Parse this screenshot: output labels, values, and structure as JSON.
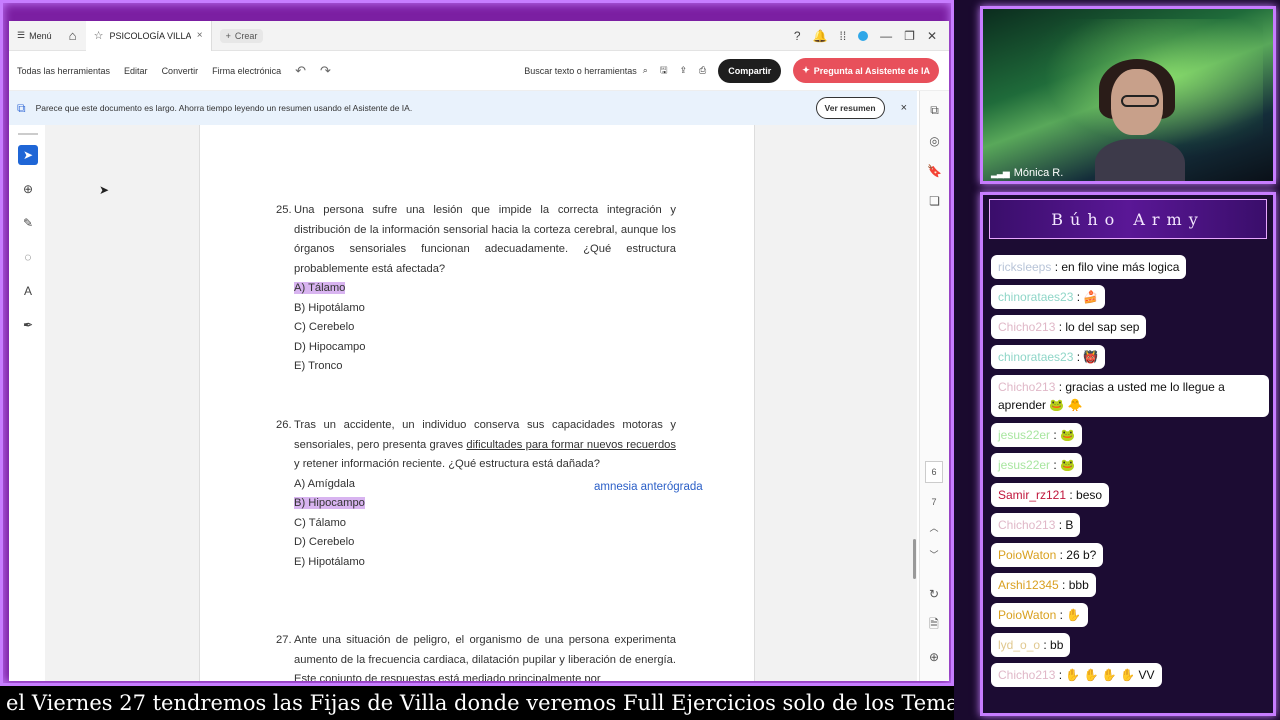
{
  "app": {
    "menu_label": "Menú",
    "tab_title": "PSICOLOGÍA VILLAR...",
    "new_tab_label": "Crear"
  },
  "toolbar": {
    "items": [
      "Todas las herramientas",
      "Editar",
      "Convertir",
      "Firma electrónica"
    ],
    "search_label": "Buscar texto o herramientas",
    "share_label": "Compartir",
    "ai_label": "Pregunta al Asistente de IA"
  },
  "notice": {
    "text": "Parece que este documento es largo. Ahorra tiempo leyendo un resumen usando el Asistente de IA.",
    "view_button": "Ver resumen",
    "close": "×"
  },
  "document": {
    "questions": [
      {
        "number": "25.",
        "stem": "Una persona sufre una lesión que impide la correcta integración y distribución de la información sensorial hacia la corteza cerebral, aunque los órganos sensoriales funcionan adecuadamente. ¿Qué estructura probablemente está afectada?",
        "options": [
          "A)  Tálamo",
          "B)  Hipotálamo",
          "C)  Cerebelo",
          "D)  Hipocampo",
          "E)  Tronco"
        ],
        "highlighted": 0
      },
      {
        "number": "26.",
        "stem_before": "Tras un accidente, un individuo conserva sus capacidades motoras y sensoriales, pero presenta graves ",
        "stem_underlined": "dificultades para formar nuevos recuerdos",
        "stem_after": " y retener información reciente. ¿Qué estructura está dañada?",
        "options": [
          "A)  Amígdala",
          "B)  Hipocampo",
          "C)  Tálamo",
          "D)  Cerebelo",
          "E)  Hipotálamo"
        ],
        "highlighted": 1,
        "annotation": "amnesia anterógrada"
      },
      {
        "number": "27.",
        "stem": "Ante una situación de peligro, el organismo de una persona experimenta aumento de la frecuencia cardiaca, dilatación pupilar y liberación de energía. Este conjunto de respuestas está mediado principalmente por"
      }
    ],
    "page_numbers": [
      "6",
      "7"
    ]
  },
  "ticker": {
    "text": "el Viernes 27 tendremos las Fijas de Villa donde veremos Full Ejercicios solo de los Temas Fijos"
  },
  "webcam": {
    "name": "Mónica R."
  },
  "chat": {
    "title": "Búho Army",
    "messages": [
      {
        "user": "ricksleeps",
        "text": " : en filo vine más logica",
        "color": "#b8c4d8"
      },
      {
        "user": "chinorataes23",
        "text": " :  🍰",
        "color": "#8fd6c8"
      },
      {
        "user": "Chicho213",
        "text": " : lo del sap sep",
        "color": "#e0b8c8"
      },
      {
        "user": "chinorataes23",
        "text": " :  👹",
        "color": "#8fd6c8"
      },
      {
        "user": "Chicho213",
        "text": " : gracias a usted me lo llegue a aprender 🐸 🐥",
        "color": "#e0b8c8"
      },
      {
        "user": "jesus22er",
        "text": " :  🐸",
        "color": "#a8e6a0"
      },
      {
        "user": "jesus22er",
        "text": " :  🐸",
        "color": "#a8e6a0"
      },
      {
        "user": "Samir_rz121",
        "text": " : beso",
        "color": "#c0163c"
      },
      {
        "user": "Chicho213",
        "text": " : B",
        "color": "#e0b8c8"
      },
      {
        "user": "PoioWaton",
        "text": " : 26 b?",
        "color": "#d9a020"
      },
      {
        "user": "Arshi12345",
        "text": " : bbb",
        "color": "#d9a020"
      },
      {
        "user": "PoioWaton",
        "text": " :  ✋",
        "color": "#d9a020"
      },
      {
        "user": "lyd_o_o",
        "text": " : bb",
        "color": "#e0c890"
      },
      {
        "user": "Chicho213",
        "text": " :  ✋ ✋ ✋ ✋ VV",
        "color": "#e0b8c8"
      }
    ]
  },
  "colors": {
    "accent_purple": "#c77dff",
    "highlight": "#d8b4f0",
    "adobe_red": "#e8505b",
    "annotation_blue": "#2b5fc7"
  }
}
